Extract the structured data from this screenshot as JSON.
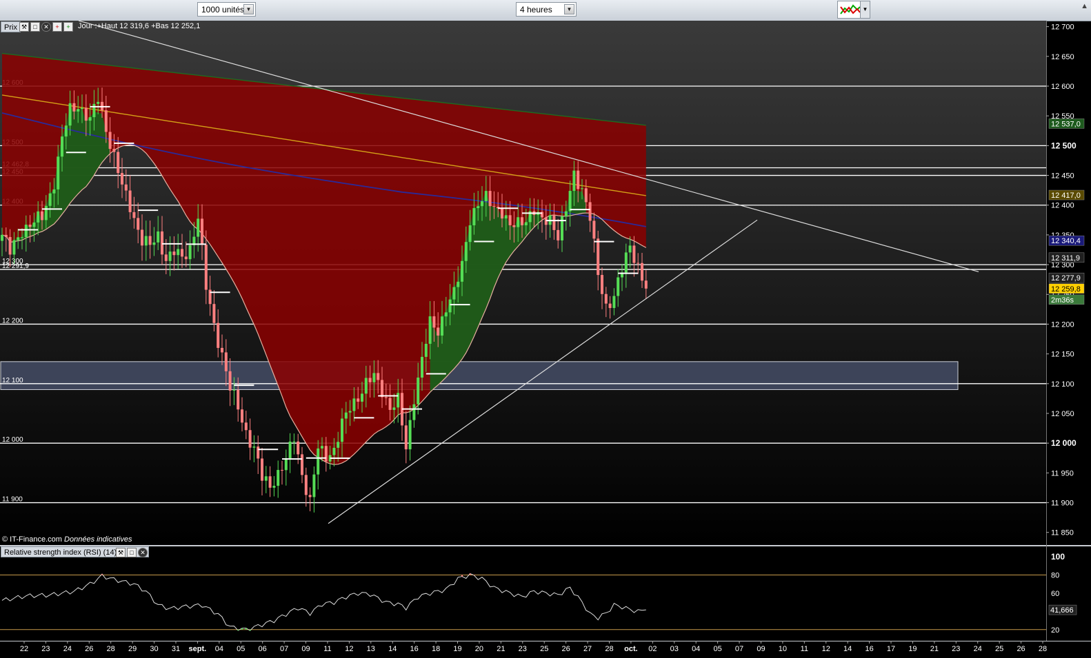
{
  "toolbar": {
    "units_value": "1000 unités",
    "timeframe_value": "4 heures",
    "chart_type_icon": "chart-type-icon",
    "dropdown_icon": "chevron-down-icon"
  },
  "price_panel": {
    "label": "Prix",
    "info": "Jour :+Haut 12 319,6 +Bas 12 252,1",
    "copyright": "© IT-Finance.com",
    "copyright_note": "Données indicatives",
    "icons": [
      "wrench-icon",
      "square-icon",
      "close-icon",
      "add-icon",
      "add-icon"
    ],
    "y_ticks": [
      "12 700",
      "12 650",
      "12 600",
      "12 550",
      "12 500",
      "12 450",
      "12 400",
      "12 350",
      "12 300",
      "12 250",
      "12 200",
      "12 150",
      "12 100",
      "12 050",
      "12 000",
      "11 950",
      "11 900",
      "11 850"
    ],
    "bold_ticks": [
      "12 500",
      "12 000"
    ],
    "level_labels": [
      "12 600",
      "12 500",
      "12 462,8",
      "12 450",
      "12 400",
      "12 300",
      "12 291,9",
      "12 200",
      "12 100",
      "12 000",
      "11 900"
    ],
    "right_badges": [
      {
        "text": "12 537,0",
        "bg": "#1d5a1d"
      },
      {
        "text": "12 417,0",
        "bg": "#5a4a00"
      },
      {
        "text": "12 340,4",
        "bg": "#1a1a7a"
      },
      {
        "text": "12 311,9",
        "bg": "#202020"
      },
      {
        "text": "12 277,9",
        "bg": "#202020"
      },
      {
        "text": "12 259,8",
        "bg": "#ffd000"
      },
      {
        "text": "2m36s",
        "bg": "#3a7a3a"
      }
    ]
  },
  "rsi_panel": {
    "title": "Relative strength index (RSI) (14)",
    "icons": [
      "wrench-icon",
      "square-icon",
      "close-icon"
    ],
    "y_ticks": [
      "100",
      "80",
      "60",
      "40",
      "20"
    ],
    "current": "41,666",
    "levels": [
      80,
      20
    ]
  },
  "x_axis": {
    "ticks": [
      "22",
      "23",
      "24",
      "26",
      "28",
      "29",
      "30",
      "31",
      "sept.",
      "04",
      "05",
      "06",
      "07",
      "09",
      "11",
      "12",
      "13",
      "14",
      "16",
      "18",
      "19",
      "20",
      "21",
      "23",
      "25",
      "26",
      "27",
      "28",
      "oct.",
      "02",
      "03",
      "04",
      "05",
      "07",
      "09",
      "10",
      "11",
      "12",
      "14",
      "16",
      "17",
      "19",
      "21",
      "23",
      "24",
      "25",
      "26",
      "28"
    ],
    "bold_ticks": [
      "sept.",
      "oct."
    ]
  },
  "colors": {
    "up": "#55dd55",
    "down": "#ff8080",
    "zone_red": "#8b0000",
    "zone_green": "#1a5e1a",
    "ma_slow": "#2a2a9a",
    "ma_gold": "#d4a017",
    "ma_fast": "#e6b0a0",
    "band": "#3d4459"
  },
  "chart_data": {
    "type": "candlestick",
    "timeframe": "4 heures",
    "ylim": [
      11830,
      12710
    ],
    "rsi_ylim": [
      10,
      100
    ],
    "horizontal_levels": [
      12600,
      12500,
      12462.8,
      12450,
      12400,
      12300,
      12291.9,
      12200,
      12100,
      12000,
      11900
    ],
    "support_band": [
      12090,
      12137
    ],
    "trendline_down": {
      "from": [
        "21",
        12710
      ],
      "to": [
        "24",
        12288
      ]
    },
    "trendline_up": {
      "from": [
        "11",
        11865
      ],
      "to": [
        "09",
        12375
      ]
    },
    "last_price": 12259.8,
    "day_high": 12319.6,
    "day_low": 12252.1,
    "ma_values_last": {
      "green": 12537.0,
      "gold": 12417.0,
      "blue": 12340.4
    },
    "rsi_last": 41.666,
    "close_path": [
      [
        0,
        12350
      ],
      [
        2,
        12320
      ],
      [
        5,
        12360
      ],
      [
        8,
        12370
      ],
      [
        10,
        12380
      ],
      [
        13,
        12440
      ],
      [
        15,
        12510
      ],
      [
        17,
        12560
      ],
      [
        19,
        12570
      ],
      [
        22,
        12540
      ],
      [
        24,
        12580
      ],
      [
        26,
        12530
      ],
      [
        28,
        12480
      ],
      [
        30,
        12430
      ],
      [
        32,
        12400
      ],
      [
        35,
        12340
      ],
      [
        37,
        12330
      ],
      [
        39,
        12350
      ],
      [
        41,
        12310
      ],
      [
        43,
        12320
      ],
      [
        45,
        12310
      ],
      [
        47,
        12330
      ],
      [
        49,
        12380
      ],
      [
        51,
        12260
      ],
      [
        53,
        12200
      ],
      [
        55,
        12150
      ],
      [
        57,
        12090
      ],
      [
        59,
        12060
      ],
      [
        61,
        12020
      ],
      [
        63,
        11990
      ],
      [
        65,
        11940
      ],
      [
        67,
        11930
      ],
      [
        69,
        11950
      ],
      [
        71,
        11970
      ],
      [
        73,
        12010
      ],
      [
        75,
        11950
      ],
      [
        77,
        11900
      ],
      [
        79,
        11990
      ],
      [
        81,
        11980
      ],
      [
        83,
        11990
      ],
      [
        85,
        12030
      ],
      [
        87,
        12060
      ],
      [
        89,
        12080
      ],
      [
        91,
        12100
      ],
      [
        93,
        12110
      ],
      [
        95,
        12090
      ],
      [
        97,
        12060
      ],
      [
        99,
        12070
      ],
      [
        101,
        11990
      ],
      [
        103,
        12080
      ],
      [
        105,
        12140
      ],
      [
        107,
        12200
      ],
      [
        109,
        12190
      ],
      [
        111,
        12230
      ],
      [
        113,
        12250
      ],
      [
        115,
        12300
      ],
      [
        117,
        12380
      ],
      [
        119,
        12400
      ],
      [
        121,
        12410
      ],
      [
        123,
        12400
      ],
      [
        125,
        12390
      ],
      [
        127,
        12360
      ],
      [
        129,
        12370
      ],
      [
        131,
        12380
      ],
      [
        133,
        12390
      ],
      [
        135,
        12370
      ],
      [
        137,
        12380
      ],
      [
        139,
        12350
      ],
      [
        141,
        12390
      ],
      [
        143,
        12450
      ],
      [
        145,
        12430
      ],
      [
        147,
        12380
      ],
      [
        149,
        12280
      ],
      [
        151,
        12230
      ],
      [
        153,
        12250
      ],
      [
        155,
        12290
      ],
      [
        157,
        12330
      ],
      [
        159,
        12300
      ],
      [
        161,
        12259.8
      ]
    ],
    "rsi_path": [
      [
        0,
        52
      ],
      [
        6,
        57
      ],
      [
        12,
        58
      ],
      [
        18,
        62
      ],
      [
        22,
        70
      ],
      [
        25,
        79
      ],
      [
        28,
        75
      ],
      [
        33,
        70
      ],
      [
        36,
        62
      ],
      [
        39,
        47
      ],
      [
        42,
        43
      ],
      [
        45,
        45
      ],
      [
        50,
        47
      ],
      [
        54,
        37
      ],
      [
        57,
        23
      ],
      [
        61,
        20
      ],
      [
        64,
        24
      ],
      [
        68,
        30
      ],
      [
        71,
        37
      ],
      [
        74,
        44
      ],
      [
        77,
        38
      ],
      [
        80,
        48
      ],
      [
        83,
        50
      ],
      [
        86,
        56
      ],
      [
        89,
        60
      ],
      [
        92,
        59
      ],
      [
        96,
        50
      ],
      [
        99,
        48
      ],
      [
        101,
        44
      ],
      [
        104,
        56
      ],
      [
        107,
        60
      ],
      [
        111,
        64
      ],
      [
        114,
        76
      ],
      [
        117,
        80
      ],
      [
        120,
        76
      ],
      [
        123,
        66
      ],
      [
        127,
        60
      ],
      [
        130,
        56
      ],
      [
        133,
        62
      ],
      [
        136,
        60
      ],
      [
        139,
        58
      ],
      [
        142,
        66
      ],
      [
        145,
        50
      ],
      [
        147,
        37
      ],
      [
        149,
        33
      ],
      [
        151,
        38
      ],
      [
        153,
        47
      ],
      [
        155,
        45
      ],
      [
        157,
        42
      ],
      [
        159,
        40
      ],
      [
        161,
        41.666
      ]
    ]
  }
}
